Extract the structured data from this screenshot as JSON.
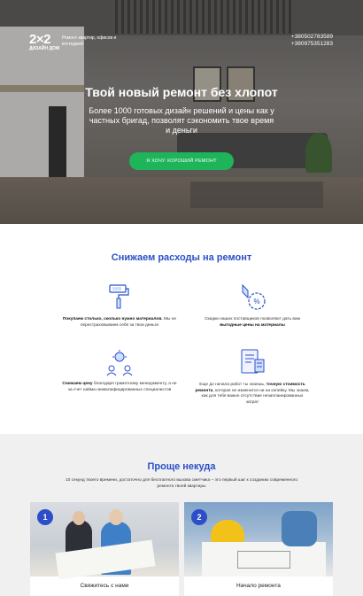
{
  "hero": {
    "logo_mark": "2×2",
    "logo_sub": "ДИЗАЙН ДОМ",
    "tagline": "Ремонт квартир, офисов и коттеджей",
    "phones": [
      "+380502783589",
      "+380975351283"
    ],
    "title": "Твой новый ремонт без хлопот",
    "subtitle": "Более 1000 готовых дизайн решений и цены как у частных бригад, позволят сэкономить твое время и деньги",
    "cta_label": "Я ХОЧУ ХОРОШИЙ РЕМОНТ",
    "cta_color": "#1eb45a"
  },
  "savings": {
    "title": "Снижаем расходы на ремонт",
    "features": [
      {
        "icon": "paint-roller-icon",
        "bold": "Покупаем столько, сколько нужно материалов.",
        "text": " Мы не перестраховываем себя за твои деньги"
      },
      {
        "icon": "discount-tag-icon",
        "pre": "Скидки наших поставщиков позволяют дать вам ",
        "bold": "выгодные цены на материалы"
      },
      {
        "icon": "idea-team-icon",
        "bold": "Снижаем цену",
        "text": " благодаря грамотному менеджменту, а не за счет найма неквалифицированных специалистов"
      },
      {
        "icon": "estimate-document-icon",
        "pre": "Еще до начала работ ты знаешь, ",
        "bold": "точную стоимость ремонта",
        "text": ", которая не изменится ни на копейку. Мы знаем, как для тебя важно отсутствие незапланированных затрат"
      }
    ]
  },
  "steps": {
    "title": "Проще некуда",
    "subtitle": "10 секунд твоего времени, достаточно для бесплатного вызова сметчика – это первый шаг к созданию современного ремонта твоей квартиры",
    "cards": [
      {
        "number": "1",
        "label": "Свяжитесь с нами"
      },
      {
        "number": "2",
        "label": "Начало ремонта"
      }
    ]
  },
  "colors": {
    "accent_blue": "#2c4fc9",
    "section_bg": "#f0f0f0"
  }
}
